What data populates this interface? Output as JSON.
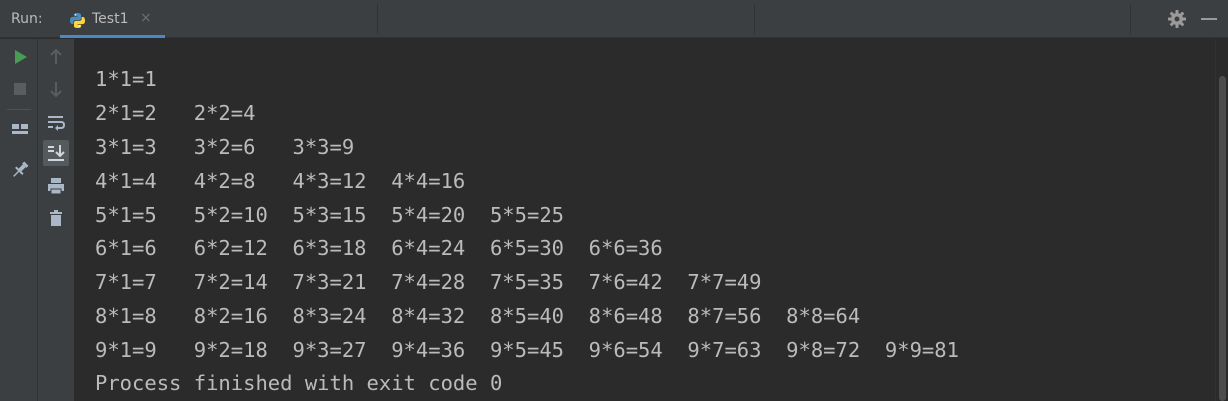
{
  "toolbar": {
    "run_label": "Run:"
  },
  "tab": {
    "name": "Test1",
    "close": "×"
  },
  "icons": {
    "run": "play-icon",
    "stop": "stop-icon",
    "layout": "layout-icon",
    "pin": "pin-icon",
    "up": "up-arrow-icon",
    "down": "down-arrow-icon",
    "wrap": "soft-wrap-icon",
    "scroll": "scroll-to-end-icon",
    "print": "print-icon",
    "trash": "trash-icon",
    "settings": "gear-icon",
    "hide": "minimize-icon"
  },
  "colors": {
    "run_green": "#499c54",
    "accent_blue": "#4a88c7",
    "text": "#bbbbbb",
    "bg": "#2b2b2b",
    "panel": "#3c3f41"
  },
  "console": {
    "lines": [
      "1*1=1",
      "2*1=2   2*2=4",
      "3*1=3   3*2=6   3*3=9",
      "4*1=4   4*2=8   4*3=12  4*4=16",
      "5*1=5   5*2=10  5*3=15  5*4=20  5*5=25",
      "6*1=6   6*2=12  6*3=18  6*4=24  6*5=30  6*6=36",
      "7*1=7   7*2=14  7*3=21  7*4=28  7*5=35  7*6=42  7*7=49",
      "8*1=8   8*2=16  8*3=24  8*4=32  8*5=40  8*6=48  8*7=56  8*8=64",
      "9*1=9   9*2=18  9*3=27  9*4=36  9*5=45  9*6=54  9*7=63  9*8=72  9*9=81"
    ],
    "exit_message": "Process finished with exit code 0"
  }
}
